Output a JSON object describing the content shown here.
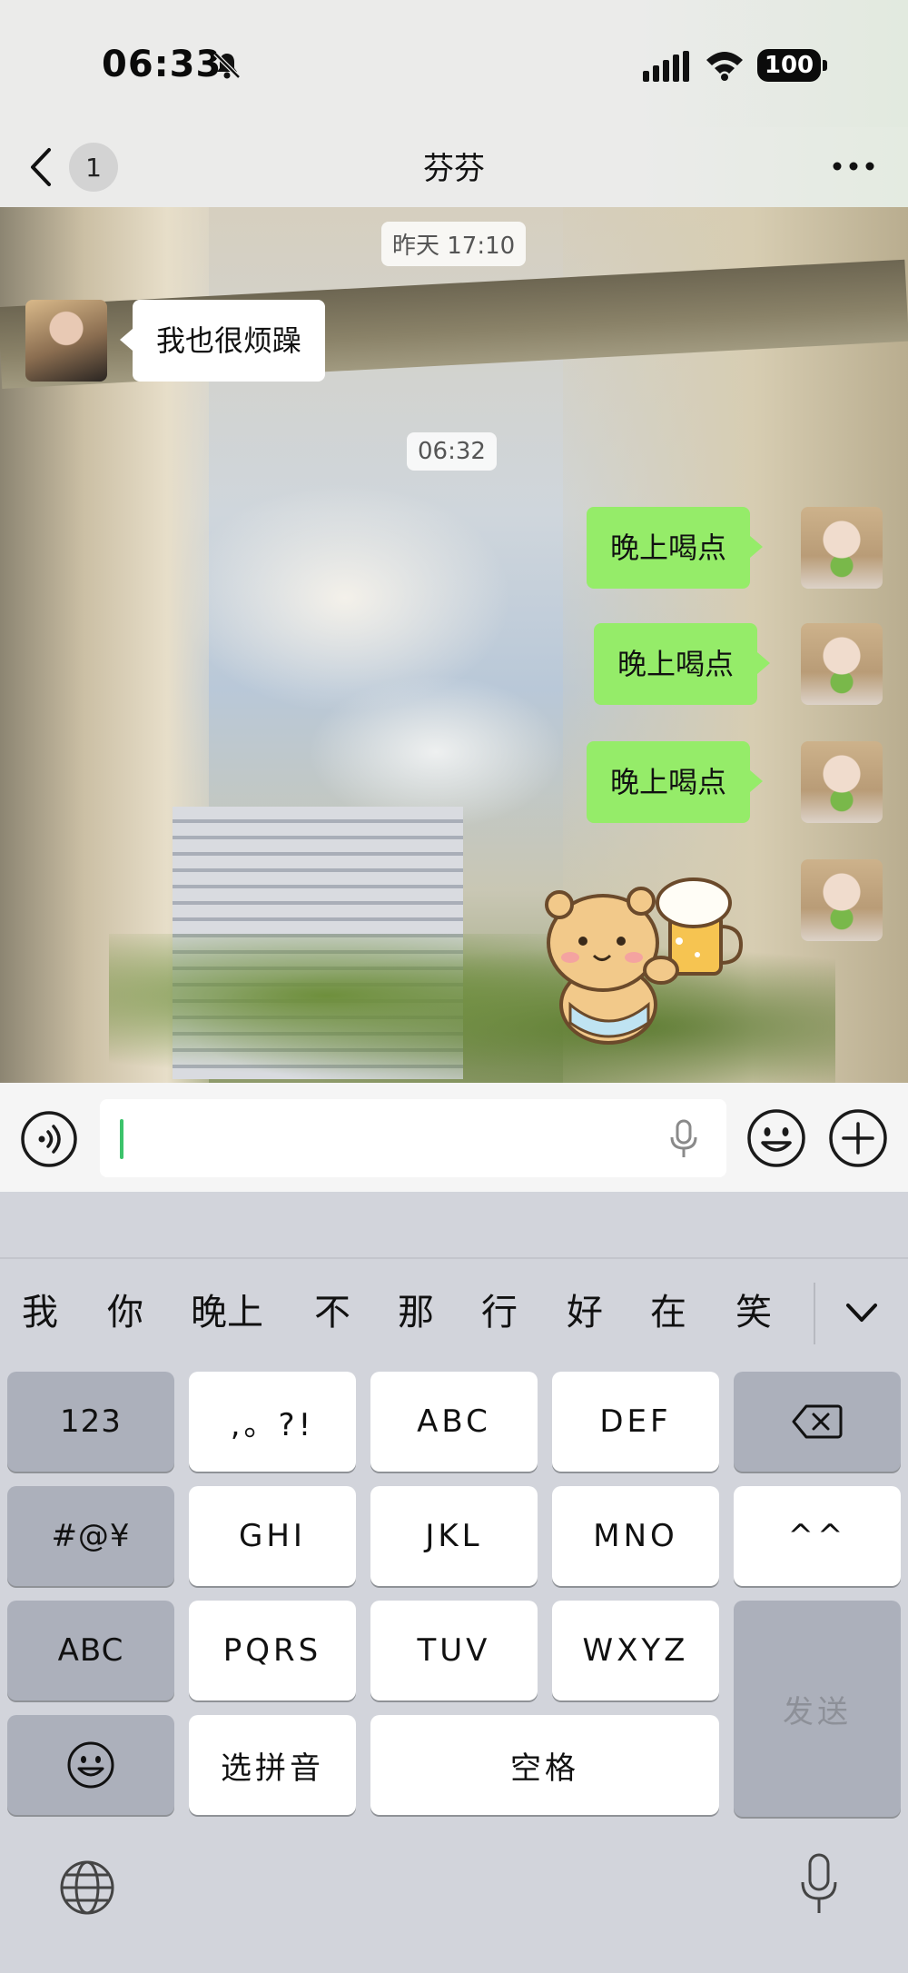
{
  "status_bar": {
    "time": "06:33",
    "battery": "100",
    "icons": [
      "bell-muted-icon",
      "signal-icon",
      "wifi-icon",
      "battery-icon"
    ]
  },
  "nav": {
    "title": "芬芬",
    "unread_count": "1",
    "icons": [
      "chevron-left-icon",
      "more-icon"
    ]
  },
  "chat": {
    "timestamps": [
      "昨天 17:10",
      "06:32"
    ],
    "messages": [
      {
        "from": "contact",
        "text": "我也很烦躁"
      },
      {
        "from": "self",
        "text": "晚上喝点"
      },
      {
        "from": "self",
        "text": "晚上喝点"
      },
      {
        "from": "self",
        "text": "晚上喝点"
      },
      {
        "from": "self",
        "sticker": "bear-beer-sticker"
      }
    ]
  },
  "input_bar": {
    "value": "",
    "icons": [
      "voice-toggle-icon",
      "microphone-icon",
      "emoji-icon",
      "plus-icon"
    ]
  },
  "keyboard": {
    "candidates": [
      "我",
      "你",
      "晚上",
      "不",
      "那",
      "行",
      "好",
      "在",
      "笑"
    ],
    "rows": [
      [
        "123",
        ",。?!",
        "ABC",
        "DEF"
      ],
      [
        "#@¥",
        "GHI",
        "JKL",
        "MNO",
        "^^"
      ],
      [
        "ABC",
        "PQRS",
        "TUV",
        "WXYZ"
      ],
      [
        "选拼音",
        "空格"
      ]
    ],
    "send_label": "发送",
    "icons": [
      "backspace-icon",
      "smiley-key-icon",
      "globe-icon",
      "keyboard-mic-icon",
      "chevron-down-icon"
    ]
  },
  "colors": {
    "outgoing_bubble": "#95ec69",
    "incoming_bubble": "#ffffff",
    "keyboard_bg": "#d2d4db",
    "function_key": "#acb0bb",
    "caret": "#3cc36b"
  }
}
